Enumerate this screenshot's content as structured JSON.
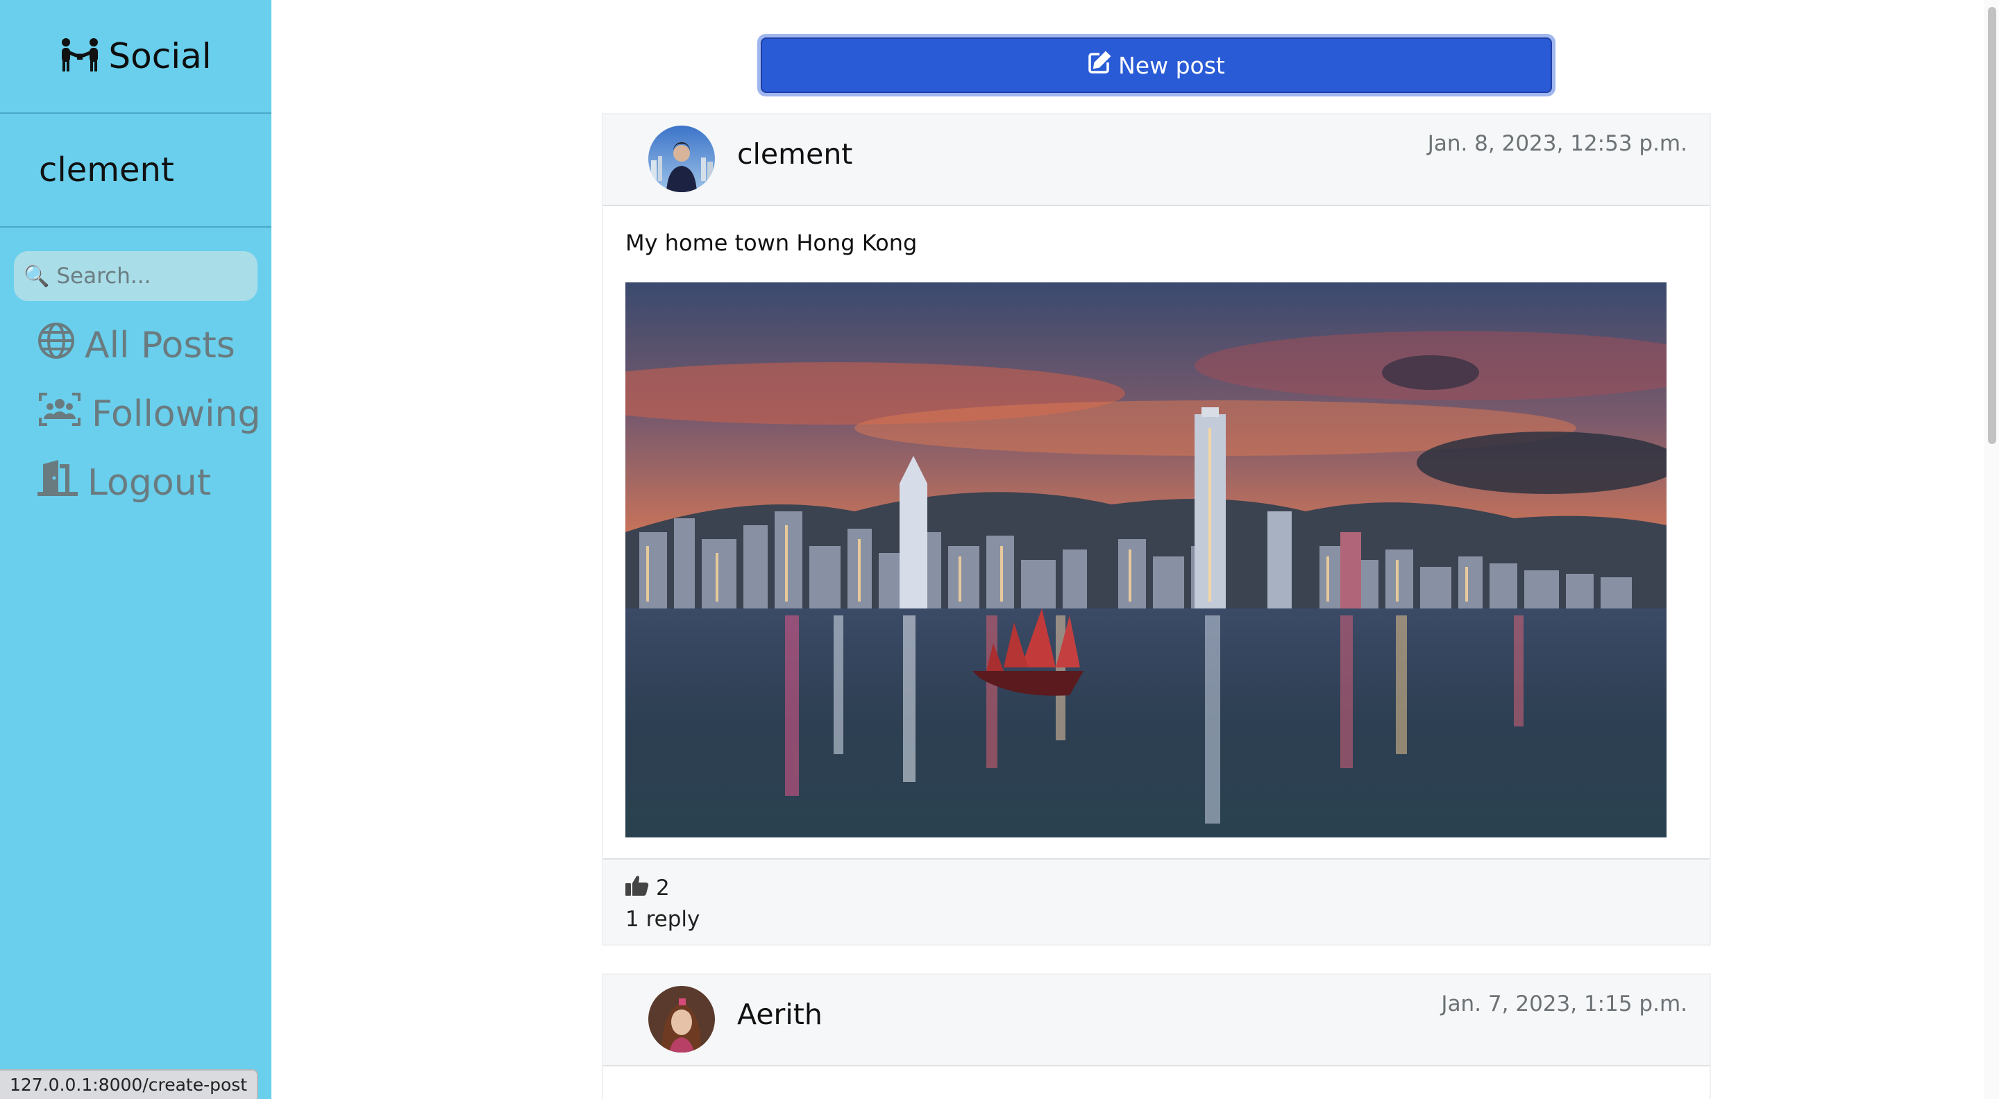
{
  "brand": {
    "name": "Social",
    "icon": "people-icon"
  },
  "user": {
    "username": "clement"
  },
  "search": {
    "placeholder": "Search..."
  },
  "nav": {
    "items": [
      {
        "label": "All Posts",
        "icon": "globe-icon"
      },
      {
        "label": "Following",
        "icon": "users-icon"
      },
      {
        "label": "Logout",
        "icon": "door-icon"
      }
    ]
  },
  "new_post": {
    "label": "New post",
    "icon": "edit-icon"
  },
  "posts": [
    {
      "author": "clement",
      "timestamp": "Jan. 8, 2023, 12:53 p.m.",
      "text": "My home town Hong Kong",
      "image": "hong-kong-skyline-photo",
      "likes": "2",
      "replies": "1 reply"
    },
    {
      "author": "Aerith",
      "timestamp": "Jan. 7, 2023, 1:15 p.m."
    }
  ],
  "statusbar": {
    "url": "127.0.0.1:8000/create-post"
  },
  "colors": {
    "sidebar": "#69cfec",
    "primary_button": "#2a5bd6",
    "nav_text": "#6a7b80"
  }
}
